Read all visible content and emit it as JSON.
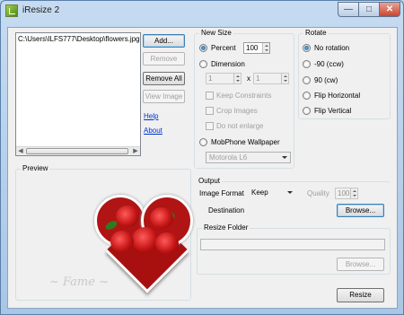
{
  "window": {
    "title": "iResize 2",
    "minimize": "—",
    "maximize": "□",
    "close": "✕"
  },
  "file_list": {
    "items": [
      "C:\\Users\\ILFS777\\Desktop\\flowers.jpg"
    ]
  },
  "buttons": {
    "add": "Add...",
    "remove": "Remove",
    "remove_all": "Remove All",
    "view_image": "View Image",
    "browse_destination": "Browse...",
    "browse_folder": "Browse...",
    "resize": "Resize"
  },
  "links": {
    "help": "Help",
    "about": "About"
  },
  "new_size": {
    "title": "New Size",
    "percent_label": "Percent",
    "percent_value": "100",
    "dimension_label": "Dimension",
    "width_value": "1",
    "times": "x",
    "height_value": "1",
    "keep_constraints": "Keep Constraints",
    "crop_images": "Crop Images",
    "do_not_enlarge": "Do not enlarge",
    "mobphone_label": "MobPhone Wallpaper",
    "mobphone_value": "Motorola L6",
    "selected": "percent"
  },
  "rotate": {
    "title": "Rotate",
    "options": [
      "No rotation",
      "-90 (ccw)",
      "90 (cw)",
      "Flip Horizontal",
      "Flip Vertical"
    ],
    "selected_index": 0
  },
  "preview": {
    "title": "Preview"
  },
  "output": {
    "title": "Output",
    "image_format_label": "Image Format",
    "image_format_value": "Keep",
    "quality_label": "Quality",
    "quality_value": "100",
    "destination_label": "Destination",
    "destination_value": ""
  },
  "resize_folder": {
    "title": "Resize Folder",
    "value": ""
  },
  "colors": {
    "link": "#0033cc",
    "accent": "#3c7fb1",
    "close": "#c94431"
  }
}
